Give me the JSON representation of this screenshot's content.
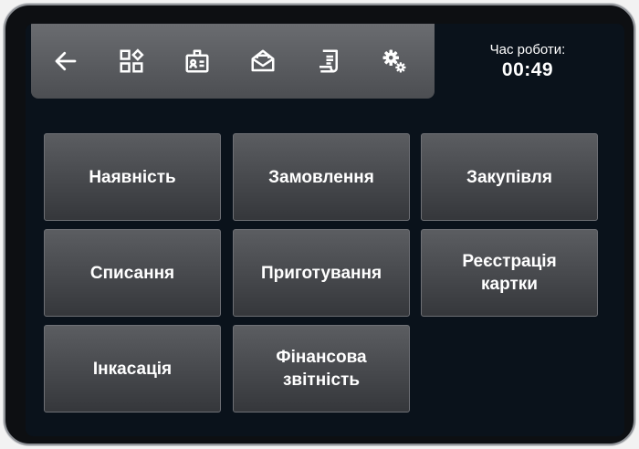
{
  "toolbar": {
    "buttons": [
      {
        "icon": "arrow-left-icon"
      },
      {
        "icon": "widgets-icon"
      },
      {
        "icon": "id-badge-icon"
      },
      {
        "icon": "open-mail-icon"
      },
      {
        "icon": "receipt-icon"
      },
      {
        "icon": "gears-icon"
      }
    ]
  },
  "timer": {
    "label": "Час роботи:",
    "value": "00:49"
  },
  "menu": {
    "items": [
      {
        "label": "Наявність"
      },
      {
        "label": "Замовлення"
      },
      {
        "label": "Закупівля"
      },
      {
        "label": "Списання"
      },
      {
        "label": "Приготування"
      },
      {
        "label": "Реєстрація картки"
      },
      {
        "label": "Інкасація"
      },
      {
        "label": "Фінансова звітність"
      }
    ]
  },
  "colors": {
    "screen_bg": "#0a121b",
    "tile_top": "#5b5d61",
    "tile_bottom": "#35373b",
    "toolbar_top": "#6a6c70",
    "toolbar_bottom": "#4c4e52",
    "text": "#ffffff"
  }
}
